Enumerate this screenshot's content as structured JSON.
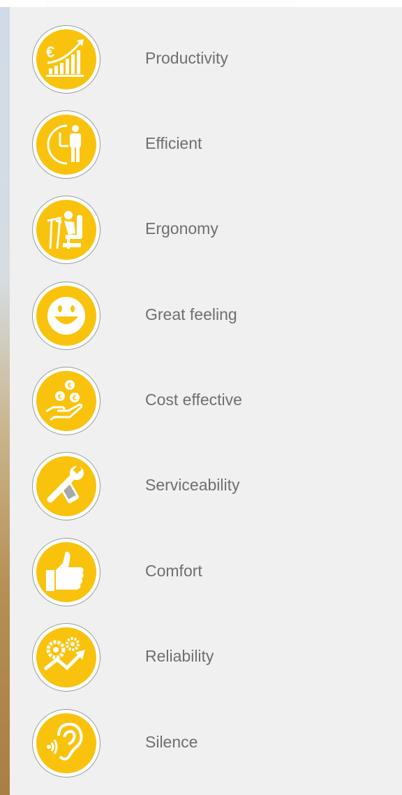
{
  "features": [
    {
      "label": "Productivity",
      "icon": "productivity-chart-icon"
    },
    {
      "label": "Efficient",
      "icon": "clock-person-icon"
    },
    {
      "label": "Ergonomy",
      "icon": "seated-operator-icon"
    },
    {
      "label": "Great feeling",
      "icon": "smiley-face-icon"
    },
    {
      "label": "Cost effective",
      "icon": "hand-coins-icon"
    },
    {
      "label": "Serviceability",
      "icon": "wrench-phone-icon"
    },
    {
      "label": "Comfort",
      "icon": "thumbs-up-icon"
    },
    {
      "label": "Reliability",
      "icon": "gears-arrow-icon"
    },
    {
      "label": "Silence",
      "icon": "ear-icon"
    }
  ],
  "colors": {
    "badge": "#f9c30d",
    "label": "#6f6f6f",
    "panel": "#f0f0f0"
  }
}
